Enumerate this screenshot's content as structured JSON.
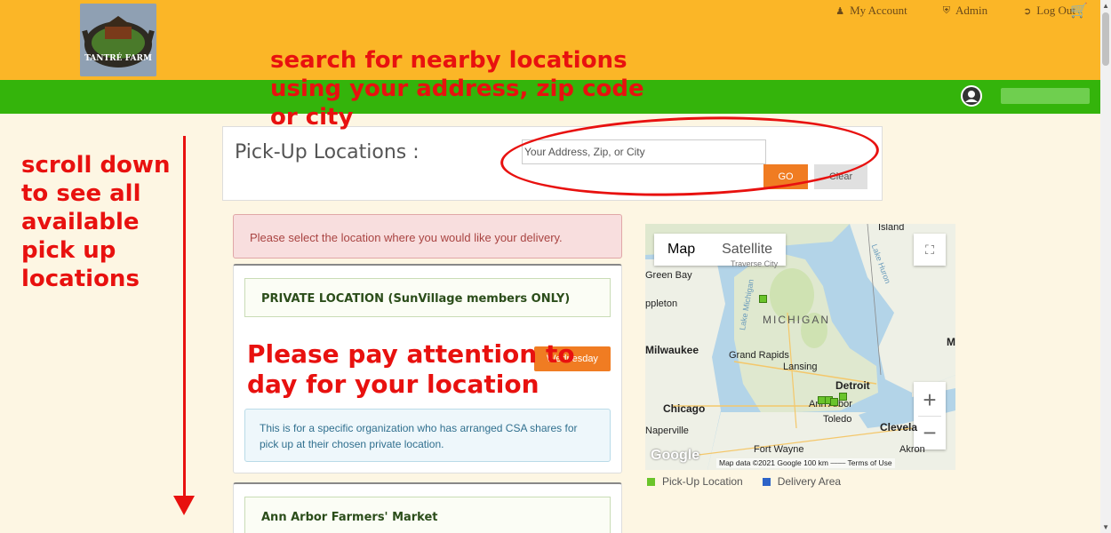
{
  "header": {
    "nav": [
      {
        "label": "My Account",
        "icon": "user-icon"
      },
      {
        "label": "Admin",
        "icon": "shield-icon"
      },
      {
        "label": "Log Out",
        "icon": "logout-icon"
      }
    ],
    "logo_text": "TANTRÉ FARM"
  },
  "annotations": {
    "search": "search for nearby locations using your address, zip code or city",
    "scroll": "scroll down to see all available pick up locations",
    "day": "Please pay attention to day for your location"
  },
  "search": {
    "title": "Pick-Up Locations :",
    "placeholder": "Your Address, Zip, or City",
    "go_label": "GO",
    "clear_label": "Clear"
  },
  "alert": "Please select the location where you would like your delivery.",
  "locations": [
    {
      "name": "PRIVATE LOCATION (SunVillage members ONLY)",
      "day": "Wednesday",
      "info": "This is for a specific organization who has arranged CSA shares for pick up at their chosen private location."
    },
    {
      "name": "Ann Arbor Farmers' Market"
    }
  ],
  "map": {
    "type_map": "Map",
    "type_satellite": "Satellite",
    "labels": {
      "island": "Island",
      "green_bay": "Green Bay",
      "appleton": "ppleton",
      "lake_michigan": "Lake Michigan",
      "lake_huron": "Lake Huron",
      "michigan": "MICHIGAN",
      "milwaukee": "Milwaukee",
      "grand_rapids": "Grand Rapids",
      "lansing": "Lansing",
      "detroit": "Detroit",
      "ann_arbor": "Ann Arbor",
      "chicago": "Chicago",
      "toledo": "Toledo",
      "naperville": "Naperville",
      "cleveland": "Clevela",
      "fort_wayne": "Fort Wayne",
      "akron": "Akron",
      "m": "M",
      "traverse": "Traverse City"
    },
    "logo": "Google",
    "attribution": "Map data ©2021 Google   100 km ⎯⎯⎯⎯   Terms of Use"
  },
  "legend": [
    {
      "label": "Pick-Up Location",
      "color": "#6ac42b"
    },
    {
      "label": "Delivery Area",
      "color": "#2e64c8"
    }
  ],
  "colors": {
    "header": "#fbb627",
    "nav_bar": "#34b40b",
    "accent": "#f07c22",
    "annotation": "#e8110f"
  }
}
